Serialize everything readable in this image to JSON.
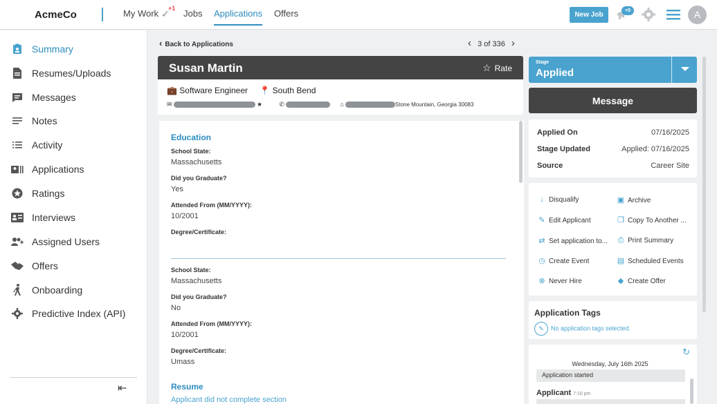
{
  "nav": {
    "brand": "AcmeCo",
    "links": [
      "My Work",
      "Jobs",
      "Applications",
      "Offers"
    ],
    "mywork_badge": "+1",
    "active": "Applications",
    "new_job": "New Job",
    "notif_badge": "+5",
    "avatar_initial": "A"
  },
  "sidebar": {
    "items": [
      {
        "label": "Summary",
        "icon": "clipboard-icon"
      },
      {
        "label": "Resumes/Uploads",
        "icon": "document-icon"
      },
      {
        "label": "Messages",
        "icon": "chat-icon"
      },
      {
        "label": "Notes",
        "icon": "notes-icon"
      },
      {
        "label": "Activity",
        "icon": "list-icon"
      },
      {
        "label": "Applications",
        "icon": "id-card-icon"
      },
      {
        "label": "Ratings",
        "icon": "star-circle-icon"
      },
      {
        "label": "Interviews",
        "icon": "interview-icon"
      },
      {
        "label": "Assigned Users",
        "icon": "add-user-icon"
      },
      {
        "label": "Offers",
        "icon": "handshake-icon"
      },
      {
        "label": "Onboarding",
        "icon": "walking-person-icon"
      },
      {
        "label": "Predictive Index (API)",
        "icon": "gear-icon"
      }
    ],
    "collapse_icon": "collapse-left-icon"
  },
  "main": {
    "back": "Back to Applications",
    "pager": "3 of 336",
    "candidate_name": "Susan Martin",
    "rate": "Rate",
    "job_title": "Software Engineer",
    "location": "South Bend",
    "address_tail": "Stone Mountain, Georgia 30083",
    "education_title": "Education",
    "edu1": {
      "state_label": "School State:",
      "state": "Massachusetts",
      "grad_label": "Did you Graduate?",
      "grad": "Yes",
      "from_label": "Attended From (MM/YYYY):",
      "from": "10/2001",
      "degree_label": "Degree/Certificate:",
      "degree": ""
    },
    "edu2": {
      "state_label": "School State:",
      "state": "Massachusetts",
      "grad_label": "Did you Graduate?",
      "grad": "No",
      "from_label": "Attended From (MM/YYYY):",
      "from": "10/2001",
      "degree_label": "Degree/Certificate:",
      "degree": "Umass"
    },
    "resume_title": "Resume",
    "resume_note": "Applicant did not complete section"
  },
  "right": {
    "stage_label": "Stage",
    "stage_value": "Applied",
    "message": "Message",
    "applied_on_label": "Applied On",
    "applied_on": "07/16/2025",
    "stage_updated_label": "Stage Updated",
    "stage_updated": "Applied: 07/16/2025",
    "source_label": "Source",
    "source": "Career Site",
    "actions": {
      "disqualify": "Disqualify",
      "archive": "Archive",
      "edit": "Edit Applicant",
      "copy": "Copy To Another ...",
      "set_app": "Set application to...",
      "print": "Print Summary",
      "create_event": "Create Event",
      "scheduled": "Scheduled Events",
      "never_hire": "Never Hire",
      "create_offer": "Create Offer"
    },
    "tags_title": "Application Tags",
    "tags_empty": "No application tags selected.",
    "activity_date": "Wednesday, July 16th 2025",
    "activity_note": "Application started",
    "activity_author": "Applicant",
    "activity_time": "7:10 pm"
  },
  "colors": {
    "accent": "#4aa3cf",
    "dark": "#444444",
    "badge": "#e54b4b"
  }
}
